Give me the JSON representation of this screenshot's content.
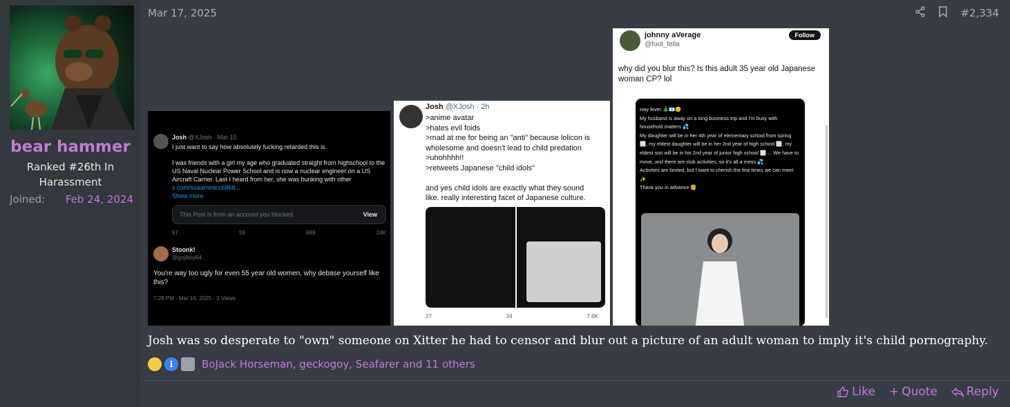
{
  "user": {
    "name": "bear hammer",
    "rank_line1": "Ranked #26th In",
    "rank_line2": "Harassment",
    "joined_label": "Joined:",
    "joined_date": "Feb 24, 2024"
  },
  "post": {
    "date": "Mar 17, 2025",
    "number": "#2,334",
    "caption": "Josh was so desperate to \"own\" someone on Xitter he had to censor and blur out a picture of an adult woman to imply it's child pornography.",
    "reactors": "BoJack Horseman, geckogoy, Seafarer and 11 others"
  },
  "actions": {
    "like": "Like",
    "quote": "Quote",
    "reply": "Reply"
  },
  "shot1": {
    "author": "Josh",
    "handle": "@XJosh · Mar 15",
    "text1": "I just want to say how absolutely fucking retarded this is.",
    "text2": "I was friends with a girl my age who graduated straight from highschool to the US Naval Nuclear Power School and is now a nuclear engineer on a US Aircraft Carrier. Last I heard from her, she was bunking with other",
    "link": "x.com/ssaammicc6868...",
    "show_more": "Show more",
    "blocked": "This Post is from an account you blocked.",
    "view": "View",
    "c1": "67",
    "c2": "59",
    "c3": "689",
    "c4": "24K",
    "reply_author": "Stoonk!",
    "reply_handle": "@goyboy64",
    "reply_text": "You're way too ugly for even 55 year old women, why debase yourself like this?",
    "reply_meta": "7:28 PM · Mar 16, 2025 · 3 Views"
  },
  "shot2": {
    "author": "Josh",
    "handle": "@XJosh · 2h",
    "text": ">anime avatar\n>hates evil foids\n>mad at me for being an \"anti\" because lolicon is wholesome and doesn't lead to child predation\n>uhohhhh!!\n>retweets Japanese \"child idols\"\n\nand yes child idols are exactly what they sound like. really interesting facet of Japanese culture.",
    "v1": "27",
    "v2": "34",
    "v3": "7.6K"
  },
  "shot3": {
    "author": "johnny aVerage",
    "handle": "@foot_fella",
    "follow": "Follow",
    "text": "why did you blur this? Is this adult 35 year old Japanese woman CP? lol",
    "inner": "Hay fever 🎄📧😊\nMy husband is away on a long business trip and I'm busy with household matters 💦\nMy daughter will be in her 4th year of elementary school from spring ⬜, my eldest daughter will be in her 2nd year of high school ⬜, my eldest son will be in his 2nd year of junior high school ⬜ ... We have to move, and there are club activities, so it's all a mess 💦\nActivities are limited, but I want to cherish the few times we can meet ✨\nThank you in advance 🍔"
  },
  "colors": {
    "accent": "#c27ad3",
    "bg": "#383c45"
  }
}
